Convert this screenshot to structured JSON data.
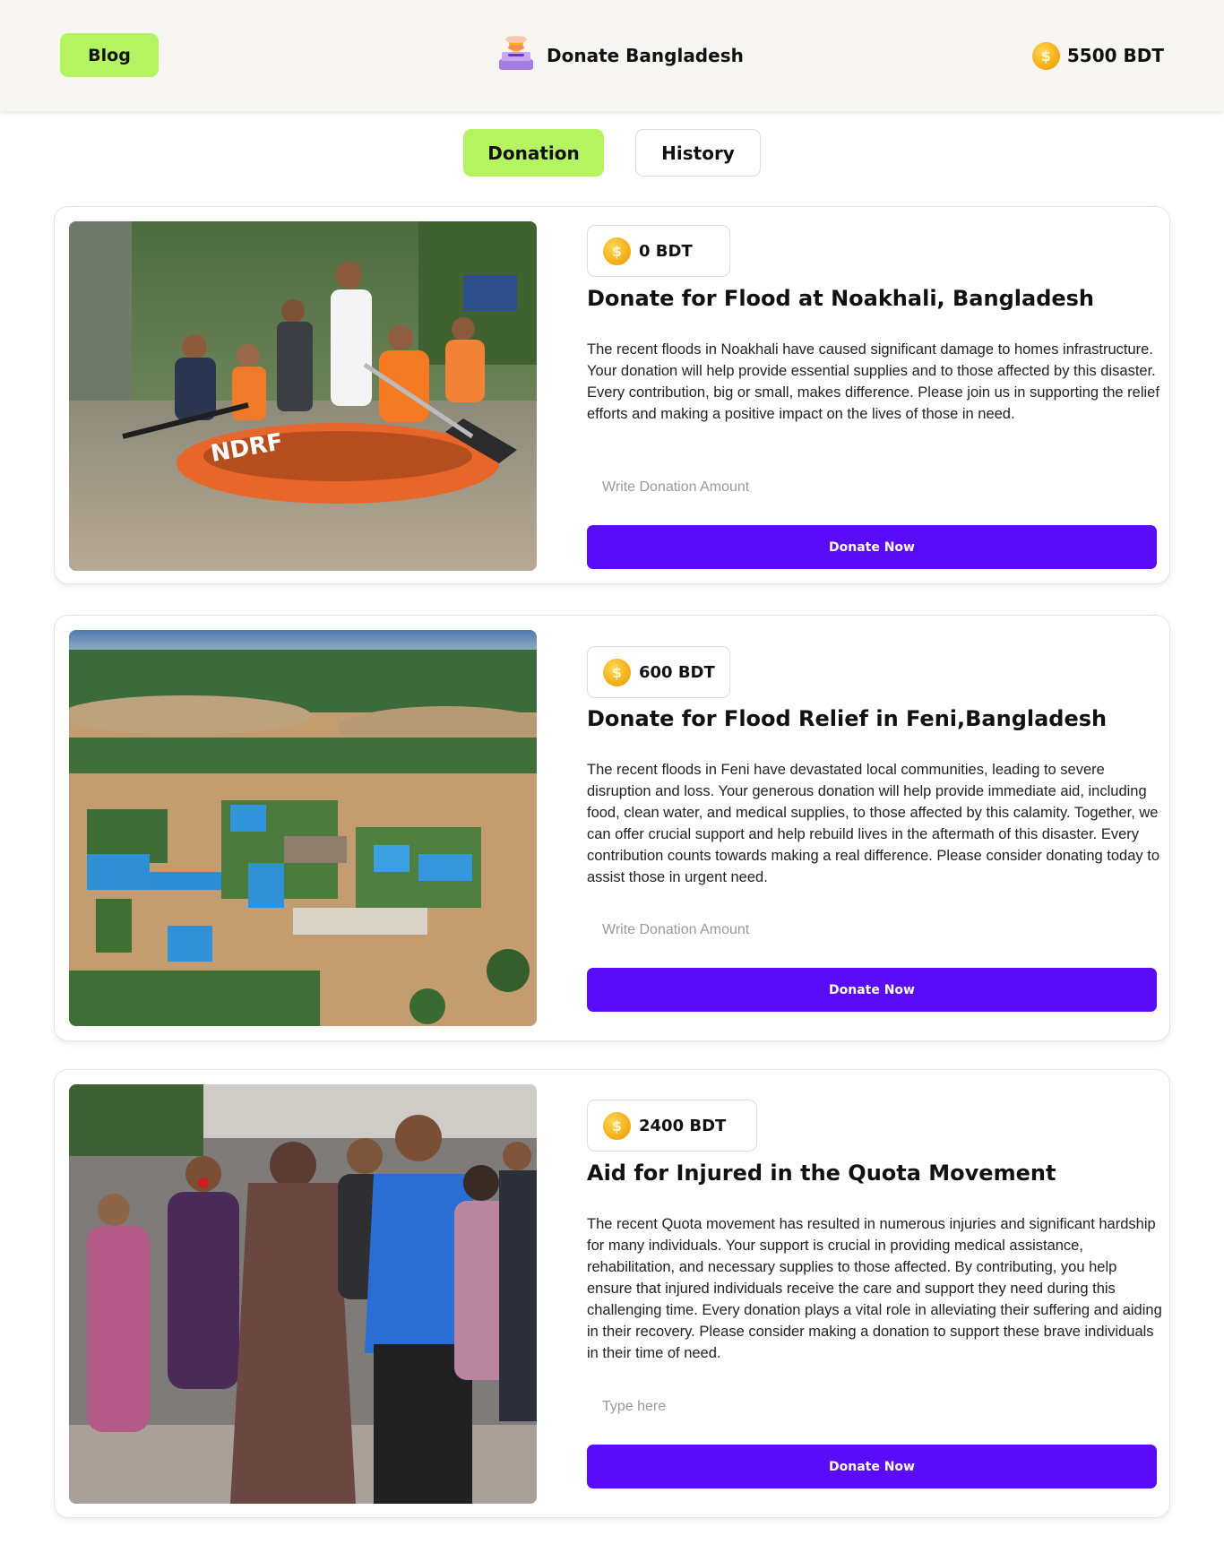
{
  "header": {
    "blog_label": "Blog",
    "brand_title": "Donate Bangladesh",
    "brand_icon": "donation-box-icon",
    "balance": "5500 BDT",
    "balance_icon": "coin-icon"
  },
  "tabs": {
    "donation": "Donation",
    "history": "History",
    "active": "Donation"
  },
  "campaigns": [
    {
      "amount": "0 BDT",
      "title": "Donate for Flood at Noakhali, Bangladesh",
      "description": "The recent floods in Noakhali have caused significant damage to homes infrastructure. Your donation will help provide essential supplies and to those affected by this disaster. Every contribution, big or small, makes difference. Please join us in supporting the relief efforts and making a positive impact on the lives of those in need.",
      "input_placeholder": "Write Donation Amount",
      "button_label": "Donate Now",
      "image_subject": "rescue-boat-flood-photo"
    },
    {
      "amount": "600 BDT",
      "title": "Donate for Flood Relief in Feni,Bangladesh",
      "description": "The recent floods in Feni have devastated local communities, leading to severe disruption and loss. Your generous donation will help provide immediate aid, including food, clean water, and medical supplies, to those affected by this calamity. Together, we can offer crucial support and help rebuild lives in the aftermath of this disaster. Every contribution counts towards making a real difference. Please consider donating today to assist those in urgent need.",
      "input_placeholder": "Write Donation Amount",
      "button_label": "Donate Now",
      "image_subject": "aerial-flooded-village-photo"
    },
    {
      "amount": "2400 BDT",
      "title": "Aid for Injured in the Quota Movement",
      "description": "The recent Quota movement has resulted in numerous injuries and significant hardship for many individuals. Your support is crucial in providing medical assistance, rehabilitation, and necessary supplies to those affected. By contributing, you help ensure that injured individuals receive the care and support they need during this challenging time. Every donation plays a vital role in alleviating their suffering and aiding in their recovery. Please consider making a donation to support these brave individuals in their time of need.",
      "input_placeholder": "Type here",
      "button_label": "Donate Now",
      "image_subject": "protest-crowd-photo"
    }
  ]
}
